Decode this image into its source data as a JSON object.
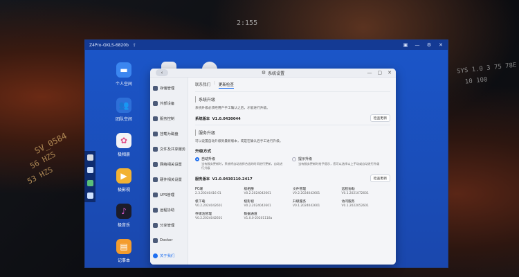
{
  "wallpaper": {
    "text_a": "SV_0584",
    "text_b": "56 HZS",
    "text_c": "53 HZS",
    "text_d": "2:155",
    "text_e": "SYS  1.0  3 75 78E",
    "text_f": "10 100",
    "colors": {
      "accent": "#c9a062"
    }
  },
  "host_window": {
    "title": "Z4Pro-GKLS-6820b",
    "title_icon": "share-icon",
    "controls": [
      "lock-icon",
      "minimize-icon",
      "settings-icon",
      "close-icon"
    ]
  },
  "desktop_icons": [
    {
      "label": "个人空间",
      "icon": "folder-icon",
      "color": "#3b86f0"
    },
    {
      "label": "团队空间",
      "icon": "team-folder-icon",
      "color": "#2d6fd8"
    },
    {
      "label": "极相册",
      "icon": "photos-icon",
      "color": "#f3f3f6"
    },
    {
      "label": "极影视",
      "icon": "video-icon",
      "color": "#f2b233"
    },
    {
      "label": "极音乐",
      "icon": "music-icon",
      "color": "#1c1c2a"
    },
    {
      "label": "记事本",
      "icon": "notes-icon",
      "color": "#f49c2d"
    }
  ],
  "dialog": {
    "title": "系统设置",
    "icon": "gear-icon",
    "sidebar": [
      {
        "label": "存储管理",
        "active": false
      },
      {
        "label": "外部设备",
        "active": false
      },
      {
        "label": "服务控制",
        "active": false
      },
      {
        "label": "挂载为磁盘",
        "active": false
      },
      {
        "label": "文件及共享服务",
        "active": false
      },
      {
        "label": "网络相关设置",
        "active": false
      },
      {
        "label": "硬件相关设置",
        "active": false
      },
      {
        "label": "UPS管理",
        "active": false
      },
      {
        "label": "远程协助",
        "active": false
      },
      {
        "label": "分享管理",
        "active": false
      },
      {
        "label": "Docker",
        "active": false
      },
      {
        "label": "关于我们",
        "active": true
      }
    ],
    "tabs": [
      {
        "label": "联系我们",
        "active": false
      },
      {
        "label": "更新检查",
        "active": true
      }
    ],
    "system_upgrade": {
      "title": "系统升级",
      "desc": "系统升级必须经用户手工确认之后，才能进行升级。",
      "version_label": "系统版本",
      "version": "V1.0.0430044",
      "check_button": "检查更新"
    },
    "service_upgrade": {
      "title": "服务升级",
      "desc": "可以设置自动升级到最新版本，或是在确认后手工进行升级。",
      "mode_title": "升级方式",
      "options": [
        {
          "title": "自动升级",
          "desc": "当有服务更新时，系统将自动选择合适的时间进行更新，自动进行升级",
          "selected": true
        },
        {
          "title": "提示升级",
          "desc": "当有服务更新时给予提示，您可以选择以上手动或自动进行升级",
          "selected": false
        }
      ],
      "version_label": "服务版本",
      "version": "V1.0.0430110.2417",
      "check_button": "检查更新",
      "services": [
        {
          "name": "PC端",
          "version": "2.3.20240416 01"
        },
        {
          "name": "极相册",
          "version": "V0.2.2024042601"
        },
        {
          "name": "文件管理",
          "version": "V0.2.2024042601"
        },
        {
          "name": "远程协助",
          "version": "V0.1.2021072601"
        },
        {
          "name": "极下载",
          "version": "V0.2.2024042601"
        },
        {
          "name": "极影视",
          "version": "V0.2.2024042601"
        },
        {
          "name": "升级服务",
          "version": "V0.1.2024042601"
        },
        {
          "name": "访问服务",
          "version": "V0.1.2022052601"
        },
        {
          "name": "存储池管理",
          "version": "V0.2.2024042601"
        },
        {
          "name": "数据通道",
          "version": "V1.0.0-20201118a"
        }
      ]
    }
  }
}
